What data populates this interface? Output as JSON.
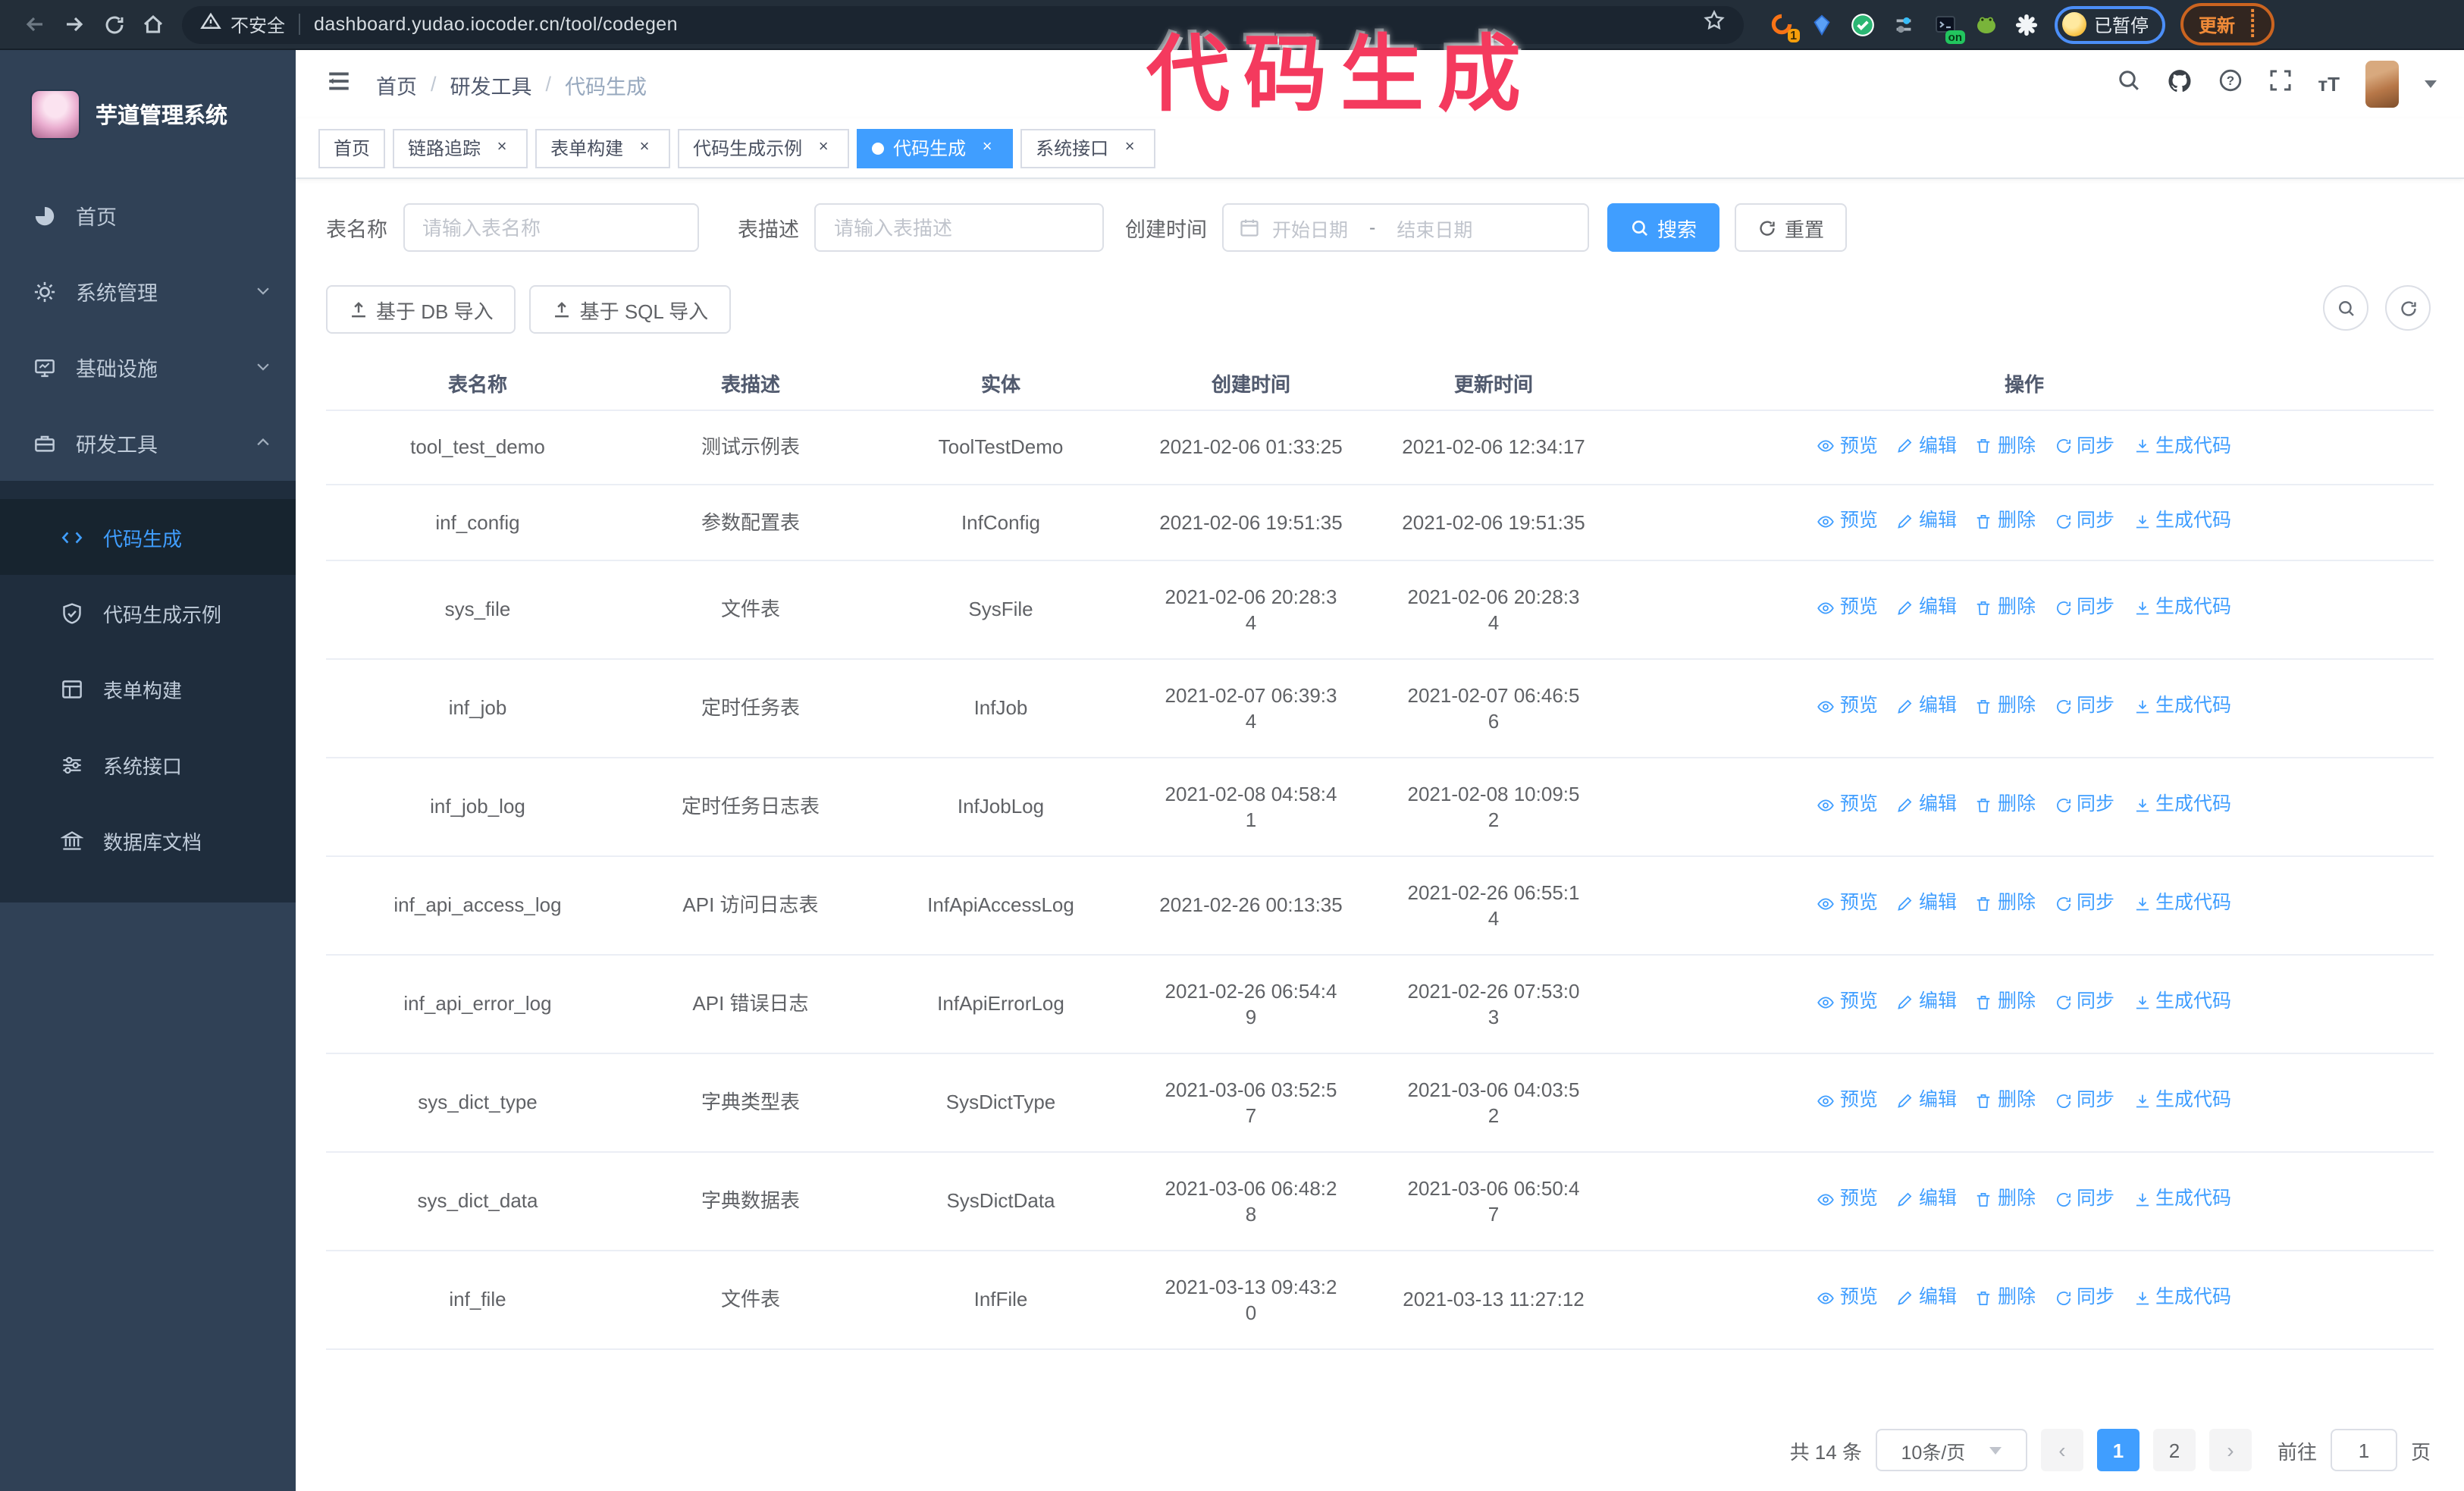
{
  "colors": {
    "primary": "#409eff",
    "annotation_pink": "#f43a5e",
    "sidebar_bg": "#304156",
    "submenu_bg": "#1f2d3d",
    "chrome_update_orange": "#ef8a38",
    "paused_border_blue": "#4b8ef7",
    "active_tab_bg": "#409eff"
  },
  "browser": {
    "security_label": "不安全",
    "url": "dashboard.yudao.iocoder.cn/tool/codegen",
    "extension_badge": "1",
    "extension_on_badge": "on",
    "paused_badge": "已暂停",
    "update_button": "更新"
  },
  "overlay": {
    "annotation": "代码生成"
  },
  "sidebar": {
    "title": "芋道管理系统",
    "items": [
      {
        "label": "首页"
      },
      {
        "label": "系统管理"
      },
      {
        "label": "基础设施"
      },
      {
        "label": "研发工具"
      }
    ],
    "subitems": [
      {
        "label": "代码生成"
      },
      {
        "label": "代码生成示例"
      },
      {
        "label": "表单构建"
      },
      {
        "label": "系统接口"
      },
      {
        "label": "数据库文档"
      }
    ]
  },
  "header": {
    "breadcrumb": [
      "首页",
      "研发工具",
      "代码生成"
    ]
  },
  "tabs": [
    {
      "label": "首页"
    },
    {
      "label": "链路追踪"
    },
    {
      "label": "表单构建"
    },
    {
      "label": "代码生成示例"
    },
    {
      "label": "代码生成"
    },
    {
      "label": "系统接口"
    }
  ],
  "filters": {
    "table_name_label": "表名称",
    "table_name_placeholder": "请输入表名称",
    "table_desc_label": "表描述",
    "table_desc_placeholder": "请输入表描述",
    "create_time_label": "创建时间",
    "date_start_placeholder": "开始日期",
    "date_separator": "-",
    "date_end_placeholder": "结束日期",
    "search_button": "搜索",
    "reset_button": "重置"
  },
  "toolbar": {
    "import_db": "基于 DB 导入",
    "import_sql": "基于 SQL 导入"
  },
  "table": {
    "columns": [
      "表名称",
      "表描述",
      "实体",
      "创建时间",
      "更新时间",
      "操作"
    ],
    "actions": [
      "预览",
      "编辑",
      "删除",
      "同步",
      "生成代码"
    ],
    "rows": [
      {
        "name": "tool_test_demo",
        "desc": "测试示例表",
        "entity": "ToolTestDemo",
        "created": "2021-02-06 01:33:25",
        "updated": "2021-02-06 12:34:17"
      },
      {
        "name": "inf_config",
        "desc": "参数配置表",
        "entity": "InfConfig",
        "created": "2021-02-06 19:51:35",
        "updated": "2021-02-06 19:51:35"
      },
      {
        "name": "sys_file",
        "desc": "文件表",
        "entity": "SysFile",
        "created": "2021-02-06 20:28:3\n4",
        "updated": "2021-02-06 20:28:3\n4"
      },
      {
        "name": "inf_job",
        "desc": "定时任务表",
        "entity": "InfJob",
        "created": "2021-02-07 06:39:3\n4",
        "updated": "2021-02-07 06:46:5\n6"
      },
      {
        "name": "inf_job_log",
        "desc": "定时任务日志表",
        "entity": "InfJobLog",
        "created": "2021-02-08 04:58:4\n1",
        "updated": "2021-02-08 10:09:5\n2"
      },
      {
        "name": "inf_api_access_log",
        "desc": "API 访问日志表",
        "entity": "InfApiAccessLog",
        "created": "2021-02-26 00:13:35",
        "updated": "2021-02-26 06:55:1\n4"
      },
      {
        "name": "inf_api_error_log",
        "desc": "API 错误日志",
        "entity": "InfApiErrorLog",
        "created": "2021-02-26 06:54:4\n9",
        "updated": "2021-02-26 07:53:0\n3"
      },
      {
        "name": "sys_dict_type",
        "desc": "字典类型表",
        "entity": "SysDictType",
        "created": "2021-03-06 03:52:5\n7",
        "updated": "2021-03-06 04:03:5\n2"
      },
      {
        "name": "sys_dict_data",
        "desc": "字典数据表",
        "entity": "SysDictData",
        "created": "2021-03-06 06:48:2\n8",
        "updated": "2021-03-06 06:50:4\n7"
      },
      {
        "name": "inf_file",
        "desc": "文件表",
        "entity": "InfFile",
        "created": "2021-03-13 09:43:2\n0",
        "updated": "2021-03-13 11:27:12"
      }
    ]
  },
  "pagination": {
    "total": "共 14 条",
    "page_size": "10条/页",
    "pages": [
      "1",
      "2"
    ],
    "active_page": "1",
    "goto_label": "前往",
    "goto_value": "1",
    "goto_unit": "页"
  }
}
